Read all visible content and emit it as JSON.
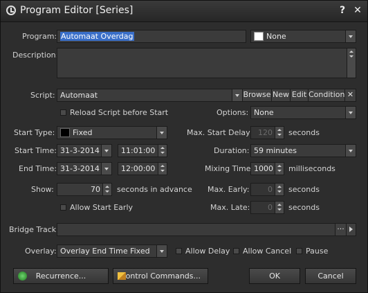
{
  "window": {
    "title": "Program Editor [Series]",
    "help_label": "?",
    "close_label": "✕"
  },
  "program": {
    "label": "Program:",
    "value": "Automaat Overdag",
    "color_value": "None",
    "color": "#ffffff"
  },
  "description": {
    "label": "Description:",
    "value": ""
  },
  "script": {
    "label": "Script:",
    "value": "Automaat",
    "browse": "Browse",
    "new": "New",
    "edit": "Edit",
    "condition": "Condition",
    "clear": "✕"
  },
  "reload": {
    "label": "Reload Script before Start",
    "checked": false
  },
  "options": {
    "label": "Options:",
    "value": "None"
  },
  "start_type": {
    "label": "Start Type:",
    "value": "Fixed",
    "color": "#000000"
  },
  "max_start_delay": {
    "label": "Max. Start Delay:",
    "value": "120",
    "unit": "seconds"
  },
  "start_time": {
    "label": "Start Time:",
    "date": "31-3-2014",
    "time": "11:01:00"
  },
  "duration": {
    "label": "Duration:",
    "value": "59 minutes"
  },
  "end_time": {
    "label": "End Time:",
    "date": "31-3-2014",
    "time": "12:00:00"
  },
  "mixing_time": {
    "label": "Mixing Time:",
    "value": "1000",
    "unit": "milliseconds"
  },
  "show": {
    "label": "Show:",
    "value": "70",
    "unit": "seconds in advance"
  },
  "max_early": {
    "label": "Max. Early:",
    "value": "0",
    "unit": "seconds"
  },
  "allow_start_early": {
    "label": "Allow Start Early",
    "checked": false
  },
  "max_late": {
    "label": "Max. Late:",
    "value": "0",
    "unit": "seconds"
  },
  "bridge_track": {
    "label": "Bridge Track:",
    "value": "",
    "more": "···"
  },
  "overlay": {
    "label": "Overlay:",
    "value": "Overlay End Time Fixed"
  },
  "allow_delay": {
    "label": "Allow Delay",
    "checked": false
  },
  "allow_cancel": {
    "label": "Allow Cancel",
    "checked": false
  },
  "pause": {
    "label": "Pause",
    "checked": false
  },
  "buttons": {
    "recurrence": "Recurrence...",
    "control_commands": "Control Commands...",
    "ok": "OK",
    "cancel": "Cancel"
  }
}
